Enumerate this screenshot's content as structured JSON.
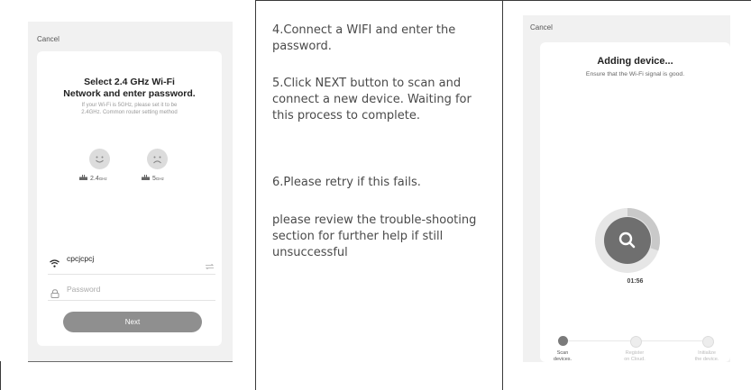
{
  "left_phone": {
    "cancel_label": "Cancel",
    "title_line1": "Select 2.4 GHz Wi-Fi",
    "title_line2": "Network and enter password.",
    "hint_line1": "If your Wi-Fi is 5GHz, please set it to be",
    "hint_line2": "2.4GHz. Common router setting method",
    "band_24_label": "2.4",
    "band_24_unit": "GHz",
    "band_5_label": "5",
    "band_5_unit": "GHz",
    "wifi_name": "cpcjcpcj",
    "password_placeholder": "Password",
    "next_label": "Next"
  },
  "instructions": {
    "step4": "4.Connect a WIFI and enter the password.",
    "step5": "5.Click NEXT button to scan and connect a new device. Waiting for this process to complete.",
    "step6": "6.Please retry if this fails.",
    "note": "please review the trouble-shooting section for further help if still unsuccessful"
  },
  "right_phone": {
    "cancel_label": "Cancel",
    "title": "Adding device...",
    "subtitle": "Ensure that the Wi-Fi signal is good.",
    "timer": "01:56",
    "progress_fraction": 0.3,
    "stages": [
      {
        "line1": "Scan",
        "line2": "devices.",
        "active": true
      },
      {
        "line1": "Register",
        "line2": "on Cloud.",
        "active": false
      },
      {
        "line1": "Initialize",
        "line2": "the device.",
        "active": false
      }
    ]
  },
  "colors": {
    "frame": "#3a3a3a",
    "button": "#8f8f8f",
    "scan_circle": "#6f6f6f",
    "text": "#4a4a4a"
  }
}
